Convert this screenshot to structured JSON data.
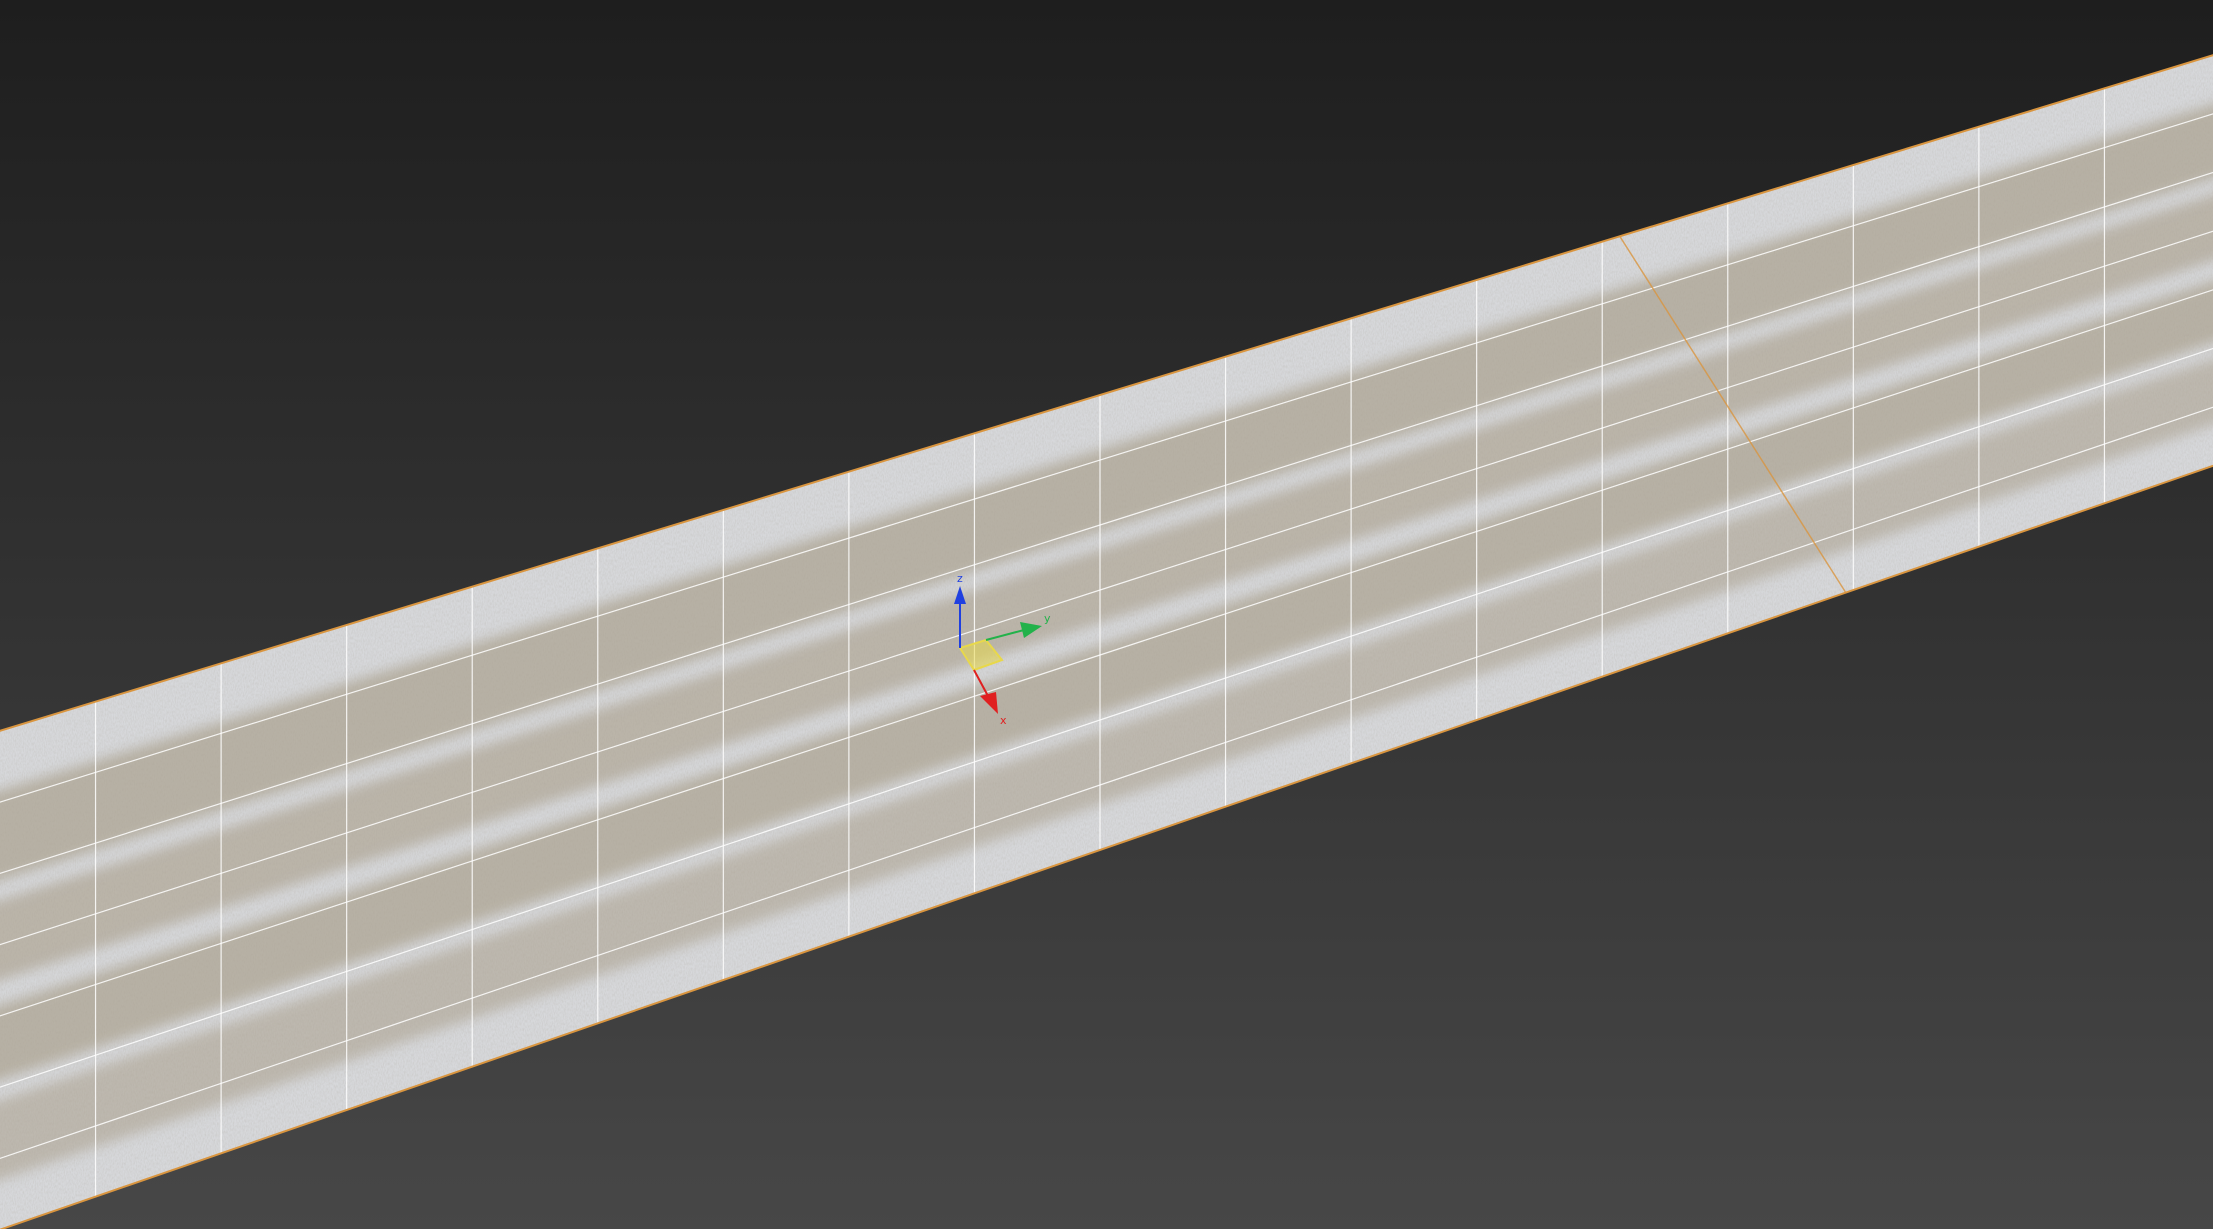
{
  "viewport": {
    "background_top": "#1e1e1e",
    "background_bottom": "#474747",
    "selection_edge_color": "#d9953f",
    "grid_line_color": "#ffffff"
  },
  "plane": {
    "length_segments": 18,
    "width_segments": 7,
    "texture": "snow-dirt-road",
    "snow_color": "#d6d8db",
    "dirt_color": "#8b7a58"
  },
  "gizmo": {
    "type": "move-transform-gizmo",
    "axes": {
      "x": {
        "label": "x",
        "color": "#e02020"
      },
      "y": {
        "label": "y",
        "color": "#22b24a"
      },
      "z": {
        "label": "z",
        "color": "#2040e0"
      }
    },
    "plane_handle_color": "#e8d84a"
  }
}
